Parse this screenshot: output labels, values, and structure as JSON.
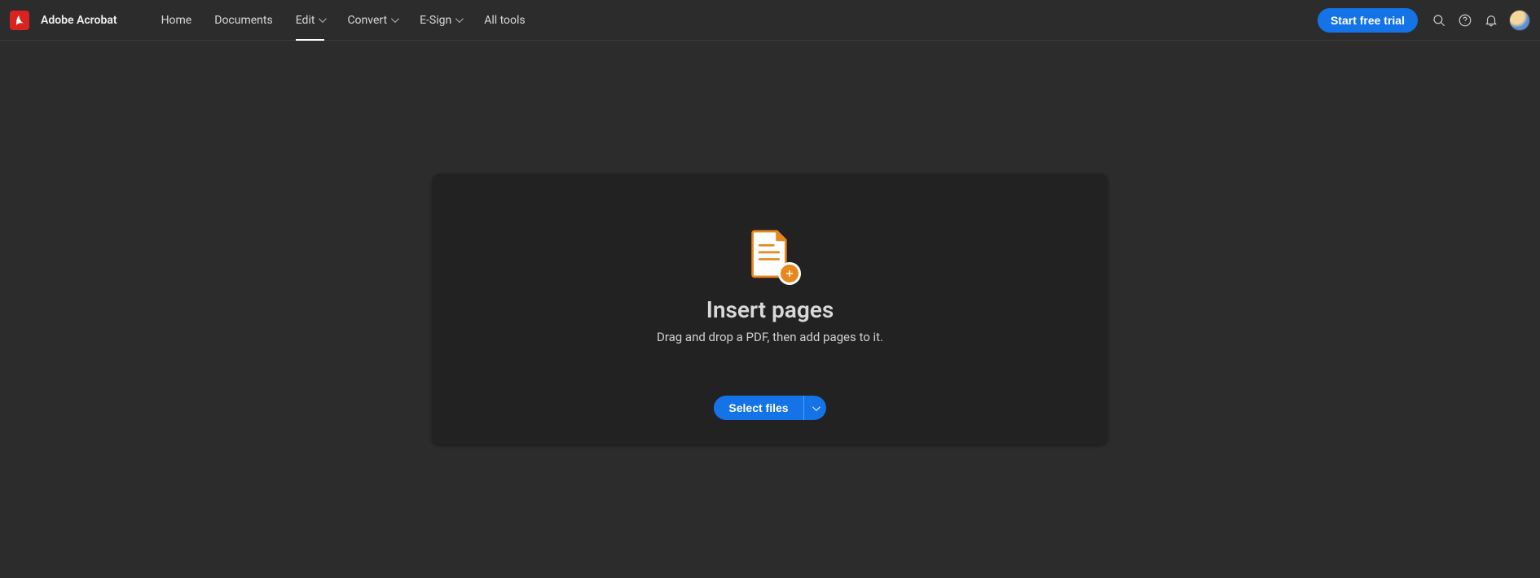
{
  "brand": "Adobe Acrobat",
  "nav": {
    "home": "Home",
    "documents": "Documents",
    "edit": "Edit",
    "convert": "Convert",
    "esign": "E-Sign",
    "alltools": "All tools"
  },
  "cta": "Start free trial",
  "card": {
    "heading": "Insert pages",
    "subtitle": "Drag and drop a PDF, then add pages to it.",
    "select_label": "Select files"
  }
}
